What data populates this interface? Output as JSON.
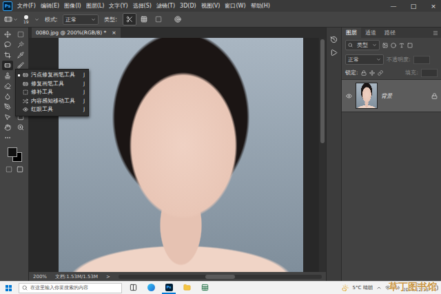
{
  "app": {
    "logo": "Ps"
  },
  "menu": [
    "文件(F)",
    "编辑(E)",
    "图像(I)",
    "图层(L)",
    "文字(Y)",
    "选择(S)",
    "滤镜(T)",
    "3D(D)",
    "视图(V)",
    "窗口(W)",
    "帮助(H)"
  ],
  "window_controls": [
    "—",
    "□",
    "×"
  ],
  "options_bar": {
    "brush_size": "19",
    "mode_label": "模式:",
    "mode_value": "正常",
    "type_label": "类型:",
    "type_modes": [
      {
        "kind": "content",
        "selected": true
      },
      {
        "kind": "texture",
        "selected": false
      },
      {
        "kind": "proximity",
        "selected": false
      }
    ]
  },
  "tools": [
    {
      "kind": "move",
      "selected": false
    },
    {
      "kind": "marquee",
      "selected": false
    },
    {
      "kind": "lasso",
      "selected": false
    },
    {
      "kind": "wand",
      "selected": false
    },
    {
      "kind": "crop",
      "selected": false
    },
    {
      "kind": "eyedropper",
      "selected": false
    },
    {
      "kind": "healing",
      "selected": true
    },
    {
      "kind": "brush",
      "selected": false
    },
    {
      "kind": "stamp",
      "selected": false
    },
    {
      "kind": "history",
      "selected": false
    },
    {
      "kind": "eraser",
      "selected": false
    },
    {
      "kind": "bucket",
      "selected": false
    },
    {
      "kind": "blur",
      "selected": false
    },
    {
      "kind": "dodge",
      "selected": false
    },
    {
      "kind": "pen",
      "selected": false
    },
    {
      "kind": "type",
      "selected": false
    },
    {
      "kind": "select",
      "selected": false
    },
    {
      "kind": "shape",
      "selected": false
    },
    {
      "kind": "hand",
      "selected": false
    },
    {
      "kind": "zoom",
      "selected": false
    },
    {
      "kind": "more",
      "selected": false
    }
  ],
  "swatches": {
    "foreground": "#111111",
    "background": "#000000"
  },
  "tool_flyout": [
    {
      "kind": "spot",
      "label": "污点修复画笔工具",
      "shortcut": "J",
      "selected": true
    },
    {
      "kind": "heal",
      "label": "修复画笔工具",
      "shortcut": "J",
      "selected": false
    },
    {
      "kind": "patch",
      "label": "修补工具",
      "shortcut": "J",
      "selected": false
    },
    {
      "kind": "contentmove",
      "label": "内容感知移动工具",
      "shortcut": "J",
      "selected": false
    },
    {
      "kind": "redeye",
      "label": "红眼工具",
      "shortcut": "J",
      "selected": false
    }
  ],
  "document_tab": {
    "title": "0080.jpg @ 200%(RGB/8) *",
    "close": "×"
  },
  "status_bar": {
    "zoom": "200%",
    "doc": "文档:1.53M/1.53M",
    "arrow": ">"
  },
  "layers_panel": {
    "tabs": [
      {
        "label": "图层",
        "selected": true
      },
      {
        "label": "通道",
        "selected": false
      },
      {
        "label": "路径",
        "selected": false
      }
    ],
    "filter": "类型",
    "blend": "正常",
    "opacity_label": "不透明度:",
    "lock_label": "锁定:",
    "fill_label": "填充:",
    "labels_disabled": true,
    "layers": [
      {
        "name": "背景",
        "visible": true,
        "locked": true,
        "selected": true
      }
    ]
  },
  "taskbar": {
    "search_placeholder": "在这里输入你要搜索的内容",
    "apps": [
      {
        "kind": "taskview",
        "active": false
      },
      {
        "kind": "edge",
        "active": false
      },
      {
        "kind": "photoshop",
        "active": true
      },
      {
        "kind": "explorer",
        "active": false
      },
      {
        "kind": "excel",
        "active": false
      }
    ],
    "weather": "5°C 晴朗",
    "time": "16:10",
    "date": "2021/12/18"
  },
  "watermark": "草丁图书馆"
}
